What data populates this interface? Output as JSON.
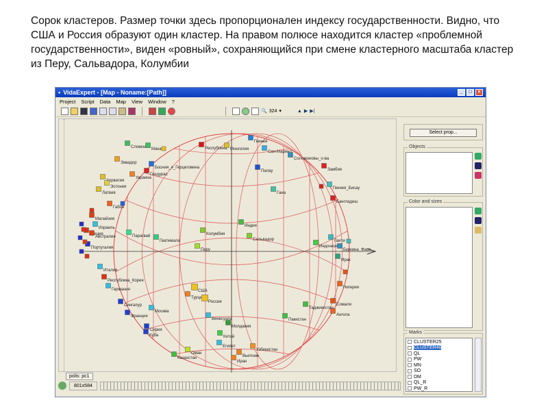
{
  "caption": "Сорок кластеров. Размер точки здесь пропорционален индексу государственности. Видно, что США и Россия образуют один кластер. На правом полюсе находится кластер «проблемной государственности», виден «ровный», сохраняющийся при смене кластерного масштаба кластер из Перу, Сальвадора, Колумбии",
  "window": {
    "title": "VidaExpert - [Map - Noname:[Path]]"
  },
  "menu": [
    "Project",
    "Script",
    "Data",
    "Map",
    "View",
    "Window",
    "?"
  ],
  "toolbar": {
    "zoom_value": "324"
  },
  "map_tab": "polis: pc1",
  "status": {
    "size": "801x584"
  },
  "right": {
    "select_button": "Select prop...",
    "objects_label": "Objects",
    "color_label": "Color and sizes",
    "marks_label": "Marks",
    "marks": [
      {
        "name": "CLUSTER25",
        "selected": false
      },
      {
        "name": "CLUSTER40",
        "selected": true
      },
      {
        "name": "QL",
        "selected": false
      },
      {
        "name": "PW",
        "selected": false
      },
      {
        "name": "MN",
        "selected": false
      },
      {
        "name": "SO",
        "selected": false
      },
      {
        "name": "DM",
        "selected": false
      },
      {
        "name": "QL_R",
        "selected": false
      },
      {
        "name": "PW_R",
        "selected": false
      }
    ]
  },
  "points": [
    {
      "label": "Словения",
      "color": "#3fbf5f"
    },
    {
      "label": "Макао",
      "color": "#3fbf5f"
    },
    {
      "label": "Республика",
      "color": "#e01010"
    },
    {
      "label": "Монголия",
      "color": "#e0c020"
    },
    {
      "label": "Гвинея",
      "color": "#2080e0"
    },
    {
      "label": "Сан-Марино",
      "color": "#30b0e0"
    },
    {
      "label": "Палау",
      "color": "#2050d0"
    },
    {
      "label": "Соломоновы_о-ва",
      "color": "#3090c0"
    },
    {
      "label": "Эквадор",
      "color": "#f0a020"
    },
    {
      "label": "Босния_и_Герцеговина",
      "color": "#2070e0"
    },
    {
      "label": "Гондурас",
      "color": "#e02020"
    },
    {
      "label": "Украина",
      "color": "#f08020"
    },
    {
      "label": "Хорватия",
      "color": "#e0c020"
    },
    {
      "label": "Эстония",
      "color": "#e0d040"
    },
    {
      "label": "Латвия",
      "color": "#e0c020"
    },
    {
      "label": "Габон",
      "color": "#f06020"
    },
    {
      "label": "Малайзия",
      "color": "#e04010"
    },
    {
      "label": "Греция",
      "color": "#e03010"
    },
    {
      "label": "Израиль",
      "color": "#30c0e0"
    },
    {
      "label": "Португалия",
      "color": "#2030d0"
    },
    {
      "label": "Австралия",
      "color": "#e04010"
    },
    {
      "label": "Италия",
      "color": "#30c0e0"
    },
    {
      "label": "Республика_Корея",
      "color": "#e03010"
    },
    {
      "label": "Германия",
      "color": "#30c0e0"
    },
    {
      "label": "Сингапур",
      "color": "#2040d0"
    },
    {
      "label": "Франция",
      "color": "#2040d0"
    },
    {
      "label": "Парагвай",
      "color": "#30e090"
    },
    {
      "label": "Гватемала",
      "color": "#30d080"
    },
    {
      "label": "Колумбия",
      "color": "#80d020"
    },
    {
      "label": "Перу",
      "color": "#a0e020"
    },
    {
      "label": "Индия",
      "color": "#40c040"
    },
    {
      "label": "Сальвадор",
      "color": "#80d020"
    },
    {
      "label": "Замбия",
      "color": "#e02020"
    },
    {
      "label": "Гвинея_Бисау",
      "color": "#40c0c0"
    },
    {
      "label": "Бангладеш",
      "color": "#e02020"
    },
    {
      "label": "Гана",
      "color": "#40c0a0"
    },
    {
      "label": "Индонезия",
      "color": "#40d040"
    },
    {
      "label": "Гаити",
      "color": "#30c0c0"
    },
    {
      "label": "Буркина_Фасо",
      "color": "#3090c0"
    },
    {
      "label": "Ирак",
      "color": "#30a080"
    },
    {
      "label": "Нигерия",
      "color": "#f06020"
    },
    {
      "label": "Сомали",
      "color": "#f05010"
    },
    {
      "label": "Ангола",
      "color": "#f06020"
    },
    {
      "label": "США",
      "color": "#f0c020"
    },
    {
      "label": "Турция",
      "color": "#f08020"
    },
    {
      "label": "Россия",
      "color": "#f0c020"
    },
    {
      "label": "Москва",
      "color": "#30c0e0"
    },
    {
      "label": "Венесуэла",
      "color": "#30c0e0"
    },
    {
      "label": "Молдавия",
      "color": "#30a030"
    },
    {
      "label": "Китай",
      "color": "#40d040"
    },
    {
      "label": "Египет",
      "color": "#30c0e0"
    },
    {
      "label": "Узбекистан",
      "color": "#f09020"
    },
    {
      "label": "Вьетнам",
      "color": "#f08020"
    },
    {
      "label": "Иран",
      "color": "#f08020"
    },
    {
      "label": "Казахстан",
      "color": "#40c040"
    },
    {
      "label": "Оман",
      "color": "#c0e020"
    },
    {
      "label": "Пакистан",
      "color": "#40c040"
    },
    {
      "label": "Таджикистан",
      "color": "#40c040"
    },
    {
      "label": "Куба",
      "color": "#2040d0"
    },
    {
      "label": "Сирия",
      "color": "#2040d0"
    }
  ]
}
